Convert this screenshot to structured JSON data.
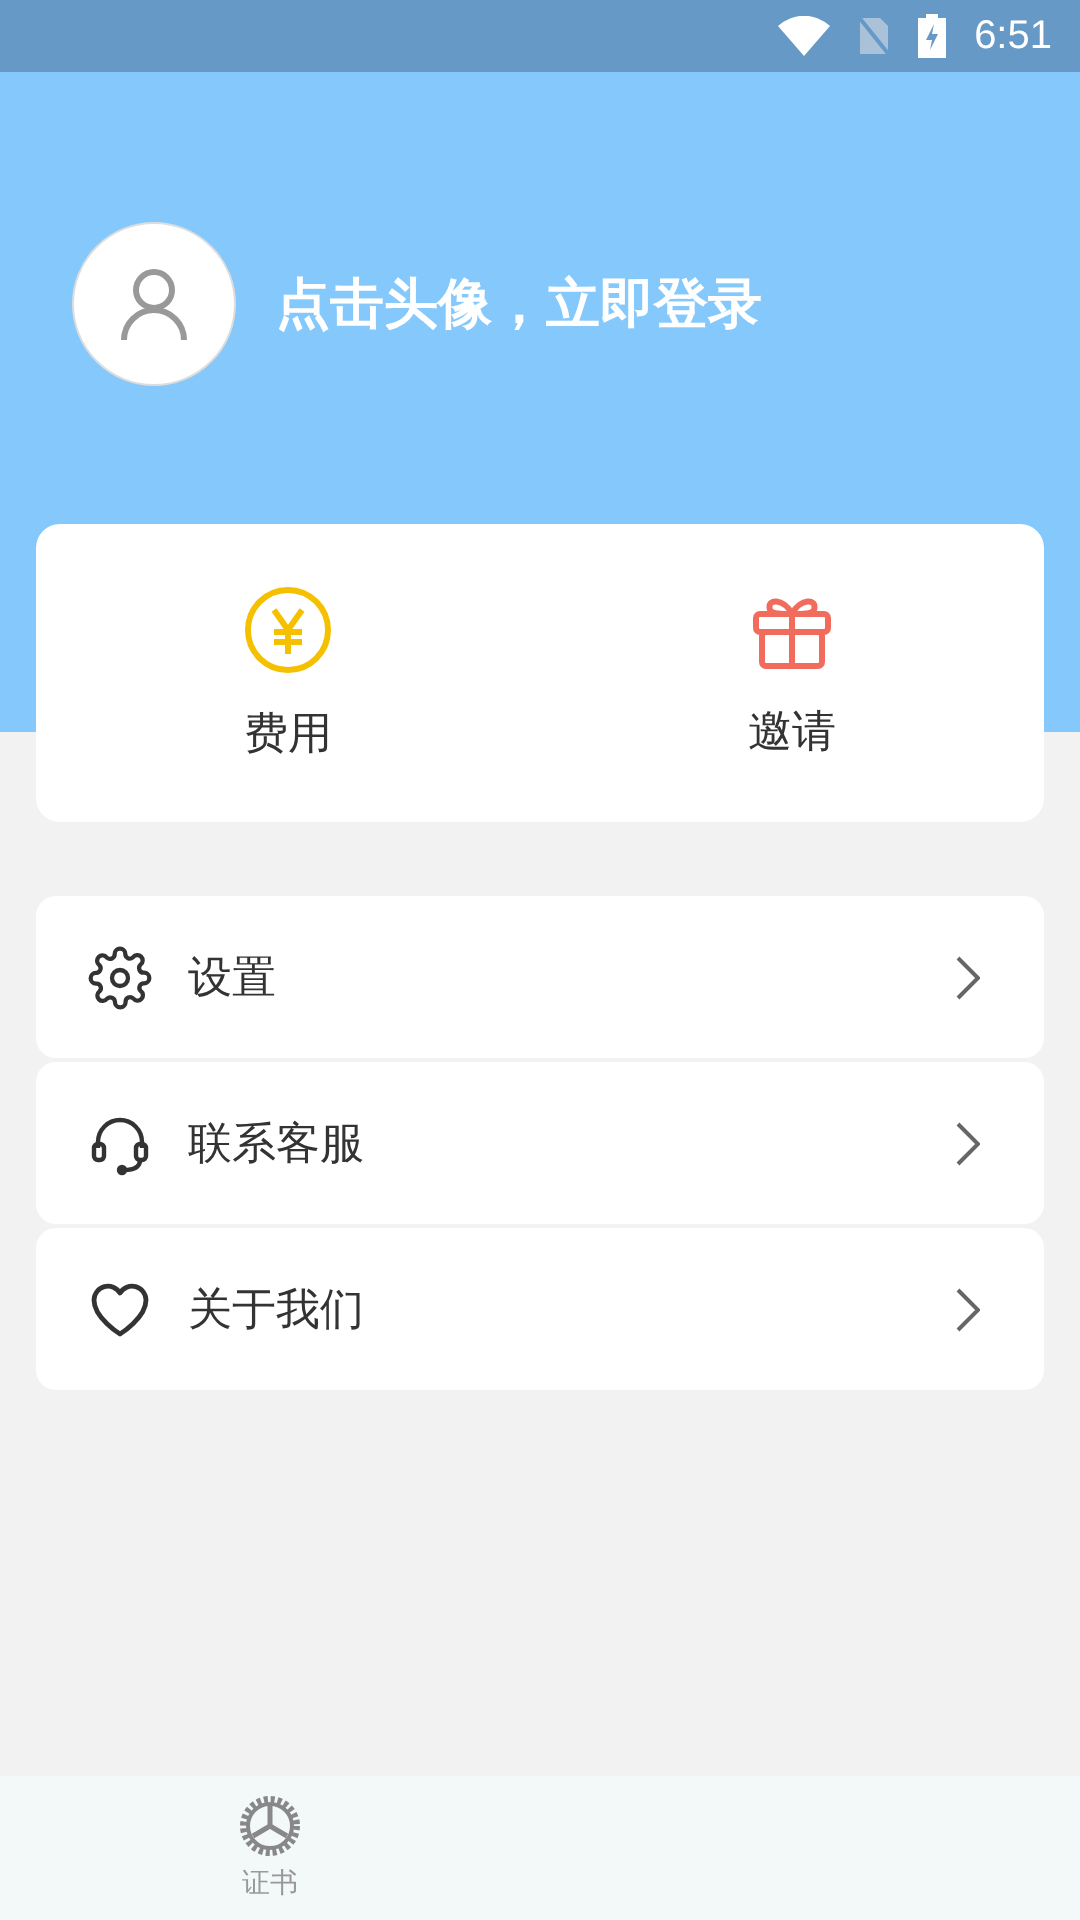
{
  "status_bar": {
    "time": "6:51"
  },
  "profile": {
    "login_prompt": "点击头像，立即登录"
  },
  "quick_actions": [
    {
      "kind": "fee",
      "label": "费用"
    },
    {
      "kind": "invite",
      "label": "邀请"
    }
  ],
  "menu": [
    {
      "kind": "settings",
      "label": "设置"
    },
    {
      "kind": "support",
      "label": "联系客服"
    },
    {
      "kind": "about",
      "label": "关于我们"
    }
  ],
  "bottom_nav": [
    {
      "kind": "certificate",
      "label": "证书",
      "selected": false
    }
  ]
}
